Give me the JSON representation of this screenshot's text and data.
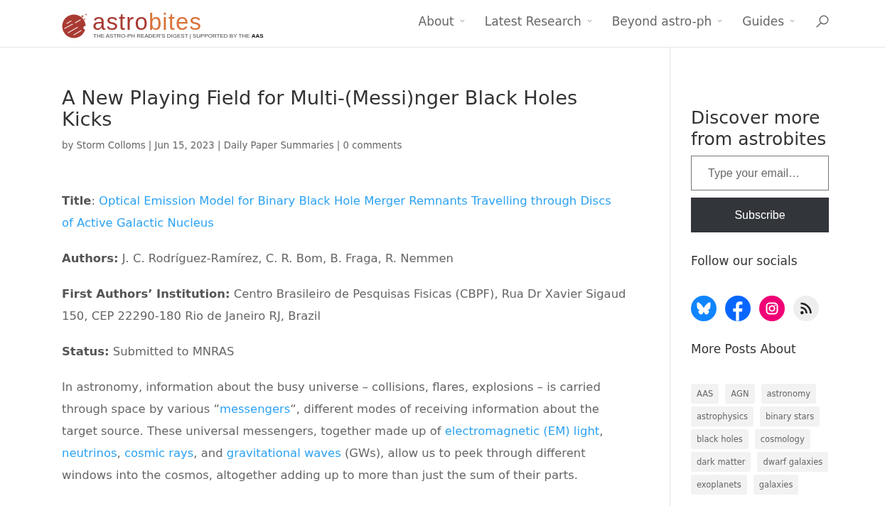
{
  "header": {
    "logo": {
      "wordmark": [
        "astro",
        "bites"
      ],
      "tagline": "THE ASTRO-PH READER'S DIGEST | SUPPORTED BY THE **AAS**"
    },
    "nav": [
      {
        "label": "About",
        "dropdown": true
      },
      {
        "label": "Latest Research",
        "dropdown": true
      },
      {
        "label": "Beyond astro-ph",
        "dropdown": true
      },
      {
        "label": "Guides",
        "dropdown": true
      }
    ]
  },
  "article": {
    "title": "A New Playing Field for Multi-(Messi)nger Black Holes Kicks",
    "meta": "by Storm Colloms | Jun 15, 2023 | Daily Paper Summaries | 0 comments",
    "paragraphs": [
      [
        {
          "kind": "text",
          "text": "**Title**: "
        },
        {
          "kind": "link",
          "text": "Optical Emission Model for Binary Black Hole Merger Remnants Travelling through Discs"
        },
        {
          "kind": "link",
          "text": "of Active Galactic Nucleus"
        }
      ],
      [
        {
          "kind": "text",
          "text": "**Authors:** J. C. Rodríguez-Ramírez, C. R. Bom, B. Fraga, R. Nemmen"
        }
      ],
      [
        {
          "kind": "text",
          "text": "**First Authors’ Institution:** Centro Brasileiro de Pesquisas Fisicas (CBPF), Rua Dr Xavier Sigaud 150, CEP 22290-180 Rio de Janeiro RJ, Brazil"
        }
      ],
      [
        {
          "kind": "text",
          "text": "**Status:** Submitted to MNRAS"
        }
      ],
      [
        {
          "kind": "text",
          "text": "In astronomy, information about the busy universe – collisions, flares, explosions – is carried through space by various “"
        },
        {
          "kind": "link",
          "text": "messengers"
        },
        {
          "kind": "text",
          "text": "“, different modes of receiving information about the target source. These universal messengers, together made up of "
        },
        {
          "kind": "link",
          "text": "electromagnetic (EM) light"
        },
        {
          "kind": "text",
          "text": ", "
        },
        {
          "kind": "link",
          "text": "neutrinos"
        },
        {
          "kind": "text",
          "text": ", "
        },
        {
          "kind": "link",
          "text": "cosmic rays"
        },
        {
          "kind": "text",
          "text": ", and "
        },
        {
          "kind": "link",
          "text": "gravitational waves"
        },
        {
          "kind": "text",
          "text": " (GWs), allow us to peek through different windows into the cosmos, altogether adding up to more than just the sum of their parts."
        }
      ]
    ]
  },
  "sidebar": {
    "subscribe": {
      "heading": "Discover more from astrobites",
      "email": {
        "placeholder": "Type your email…"
      },
      "button": "Subscribe"
    },
    "socials_heading": "Follow our socials",
    "tags_heading": "More Posts About",
    "tags": [
      "AAS",
      "AGN",
      "astronomy",
      "astrophysics",
      "binary stars",
      "black holes",
      "cosmology",
      "dark matter",
      "dwarf galaxies",
      "exoplanets",
      "galaxies"
    ]
  }
}
